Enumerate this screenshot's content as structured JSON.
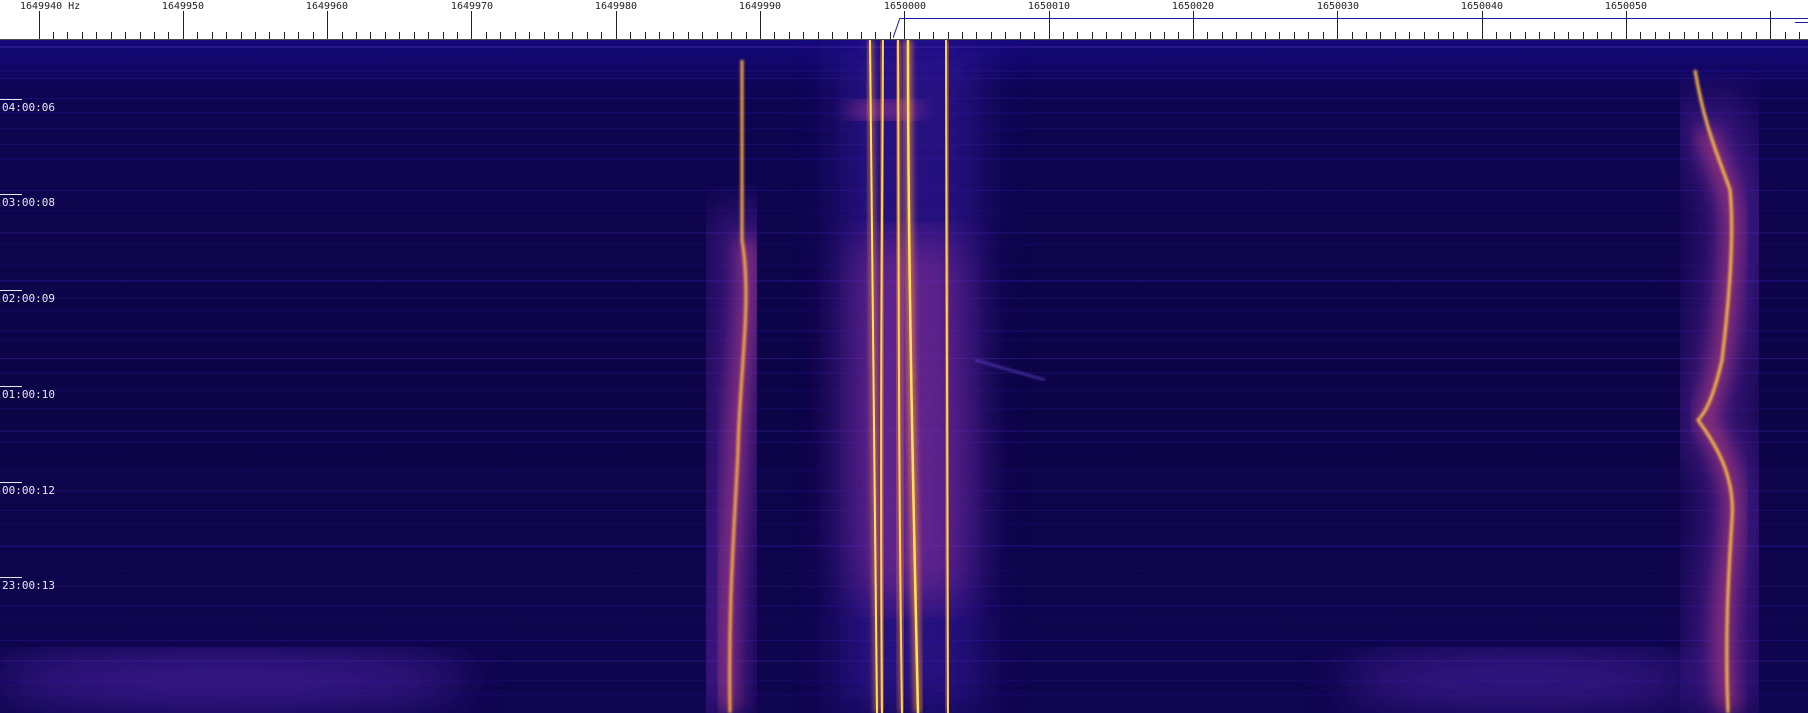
{
  "ruler": {
    "unit": "Hz",
    "first_label": "1649940 Hz",
    "labels": [
      "1649950",
      "1649960",
      "1649970",
      "1649980",
      "1649990",
      "1650000",
      "1650010",
      "1650020",
      "1650030",
      "1650040",
      "1650050"
    ]
  },
  "waterfall": {
    "time_labels": [
      "04:00:06",
      "03:00:08",
      "02:00:09",
      "01:00:10",
      "00:00:12",
      "23:00:13"
    ]
  },
  "colors": {
    "background": "#0c0440",
    "signal_low": "#3a1fb0",
    "signal_mid": "#c42a9a",
    "signal_high": "#ffd23a"
  }
}
